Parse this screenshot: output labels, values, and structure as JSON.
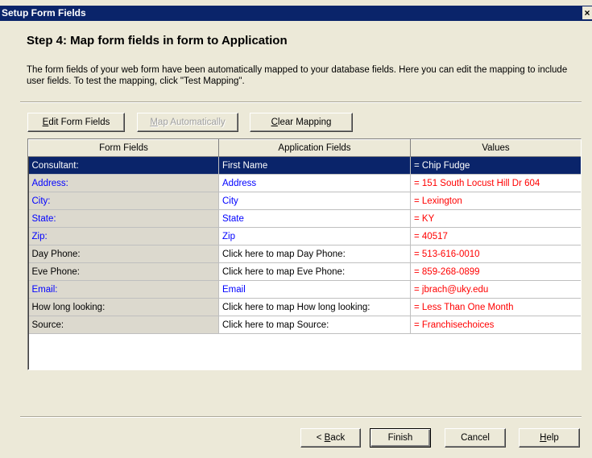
{
  "window": {
    "title": "Setup Form Fields",
    "close_label": "×"
  },
  "step_title": "Step 4: Map form fields in form to Application",
  "description": "The form fields of your web form have been automatically mapped to your database fields. Here you can edit the mapping to include user fields. To test the mapping, click \"Test Mapping\".",
  "toolbar": {
    "edit_label_accel": "E",
    "edit_label_rest": "dit Form Fields",
    "map_label_accel": "M",
    "map_label_rest": "ap Automatically",
    "clear_label_accel": "C",
    "clear_label_rest": "lear Mapping"
  },
  "grid": {
    "headers": [
      "Form Fields",
      "Application Fields",
      "Values"
    ],
    "rows": [
      {
        "form": "Consultant:",
        "app": "First Name",
        "value": "= Chip Fudge",
        "mapped": true,
        "selected": true
      },
      {
        "form": "Address:",
        "app": "Address",
        "value": "= 151 South Locust Hill Dr 604",
        "mapped": true,
        "selected": false
      },
      {
        "form": "City:",
        "app": "City",
        "value": "= Lexington",
        "mapped": true,
        "selected": false
      },
      {
        "form": "State:",
        "app": "State",
        "value": "= KY",
        "mapped": true,
        "selected": false
      },
      {
        "form": "Zip:",
        "app": "Zip",
        "value": "= 40517",
        "mapped": true,
        "selected": false
      },
      {
        "form": "Day Phone:",
        "app": "Click here to map Day Phone:",
        "value": "= 513-616-0010",
        "mapped": false,
        "selected": false
      },
      {
        "form": "Eve Phone:",
        "app": "Click here to map Eve Phone:",
        "value": "= 859-268-0899",
        "mapped": false,
        "selected": false
      },
      {
        "form": "Email:",
        "app": "Email",
        "value": "= jbrach@uky.edu",
        "mapped": true,
        "selected": false
      },
      {
        "form": "How long looking:",
        "app": "Click here to map How long looking:",
        "value": "= Less Than One Month",
        "mapped": false,
        "selected": false
      },
      {
        "form": "Source:",
        "app": "Click here to map Source:",
        "value": "= Franchisechoices",
        "mapped": false,
        "selected": false
      }
    ]
  },
  "footer": {
    "back_prefix": "< ",
    "back_accel": "B",
    "back_rest": "ack",
    "finish_label": "Finish",
    "cancel_label": "Cancel",
    "help_accel": "H",
    "help_rest": "elp"
  },
  "colors": {
    "titlebar": "#0A246A",
    "dialog_bg": "#ECE9D8",
    "mapped_text": "#0000FF",
    "value_text": "#FF0000",
    "selection": "#0A246A"
  }
}
